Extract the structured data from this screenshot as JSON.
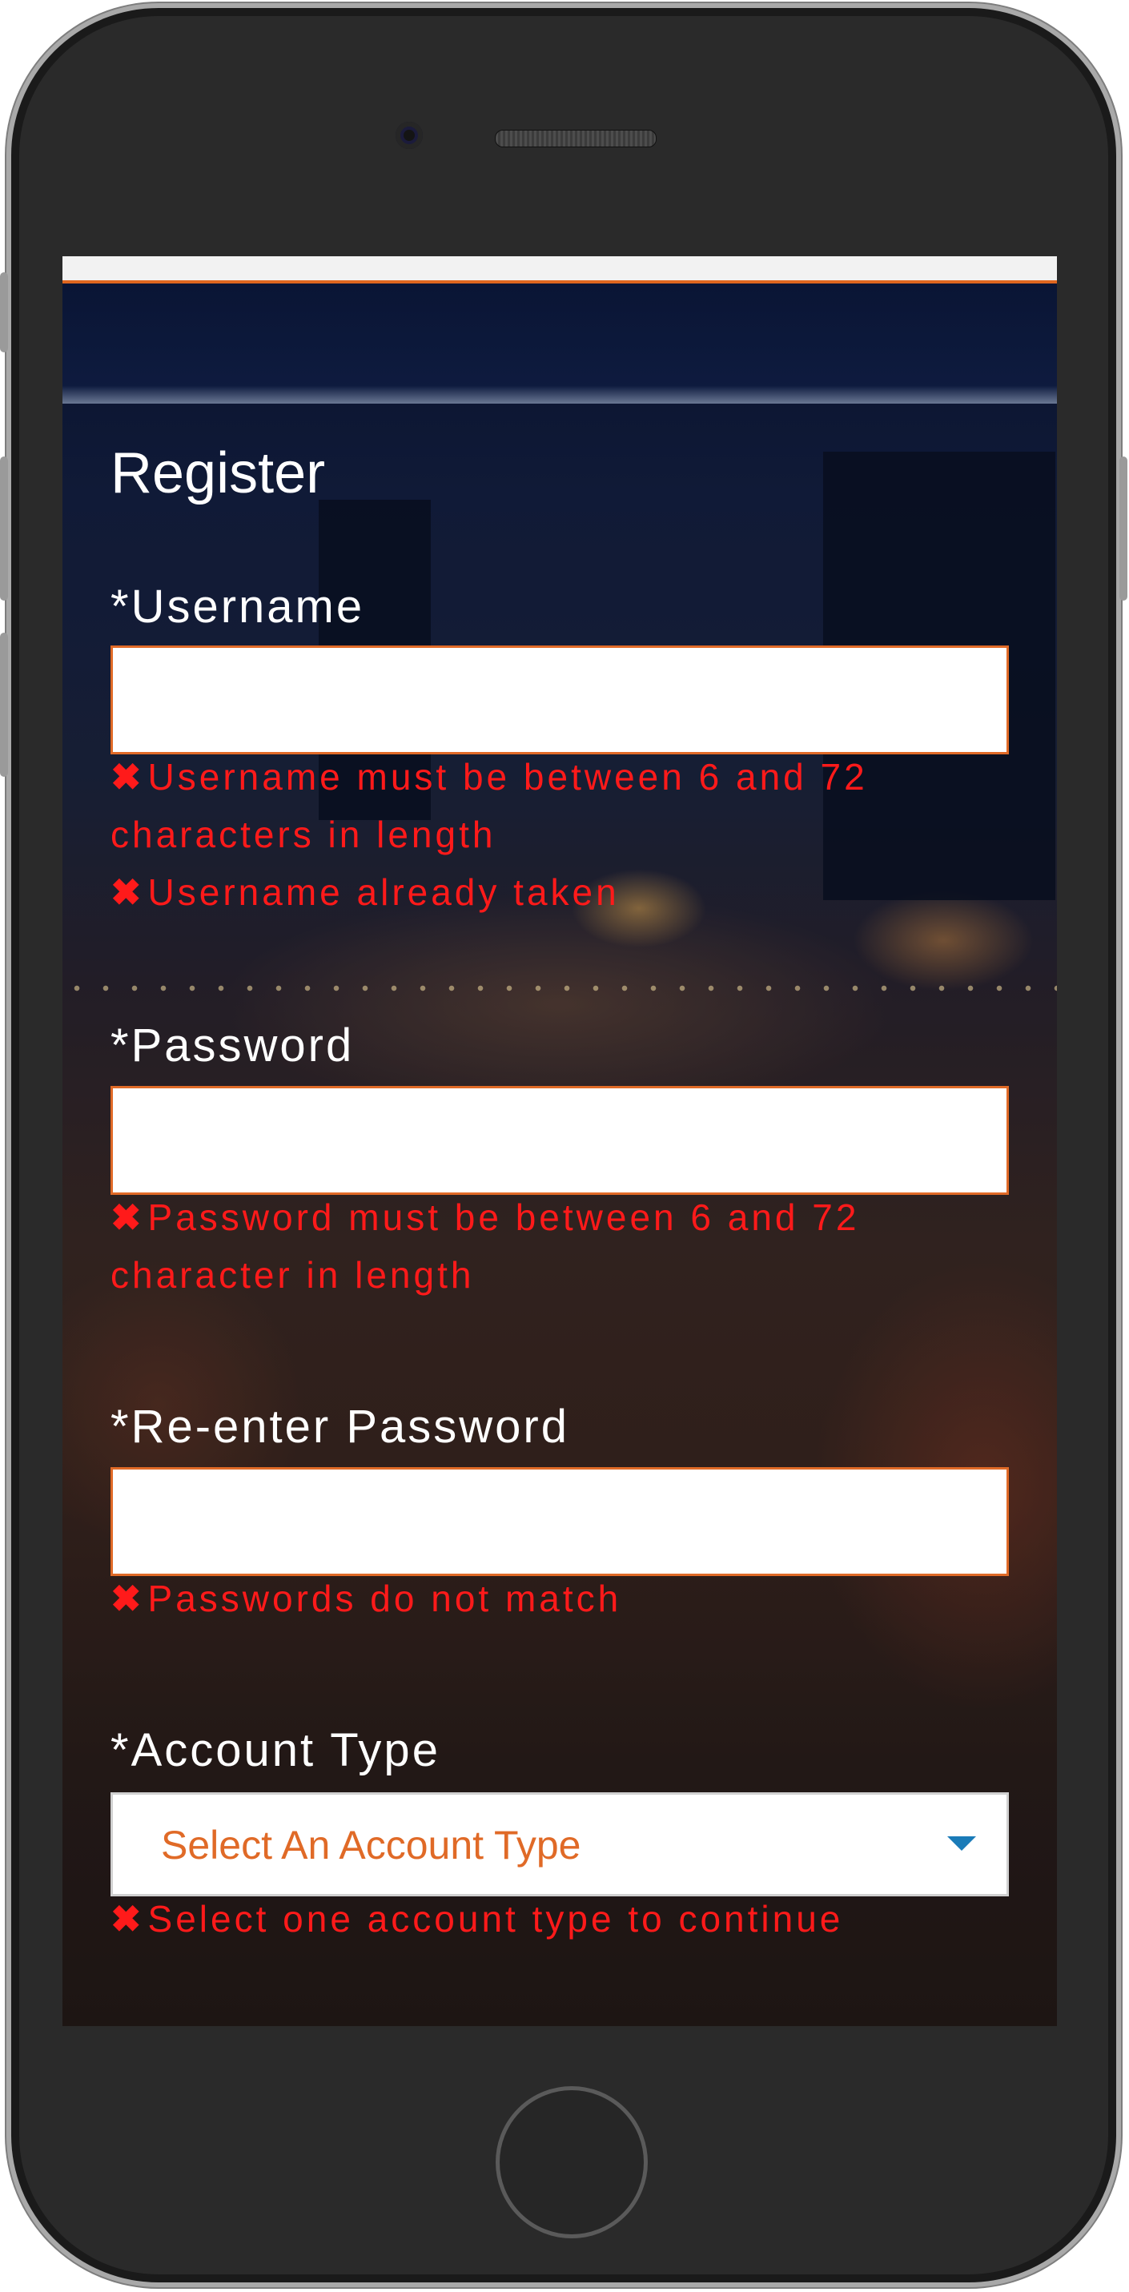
{
  "form": {
    "title": "Register",
    "username": {
      "label": "*Username",
      "value": "",
      "errors": [
        "Username must be between 6 and 72 characters in length",
        "Username already taken"
      ]
    },
    "password": {
      "label": "*Password",
      "value": "",
      "errors": [
        "Password must be between 6 and 72 character in length"
      ]
    },
    "reenter_password": {
      "label": "*Re-enter Password",
      "value": "",
      "errors": [
        "Passwords do not match"
      ]
    },
    "account_type": {
      "label": "*Account Type",
      "selected": "Select An Account Type",
      "errors": [
        "Select one account type to continue"
      ]
    }
  },
  "icons": {
    "error": "close-icon",
    "dropdown": "caret-down-icon"
  },
  "colors": {
    "accent": "#e06a27",
    "error": "#ff1a1a",
    "caret": "#1a7bb8"
  }
}
